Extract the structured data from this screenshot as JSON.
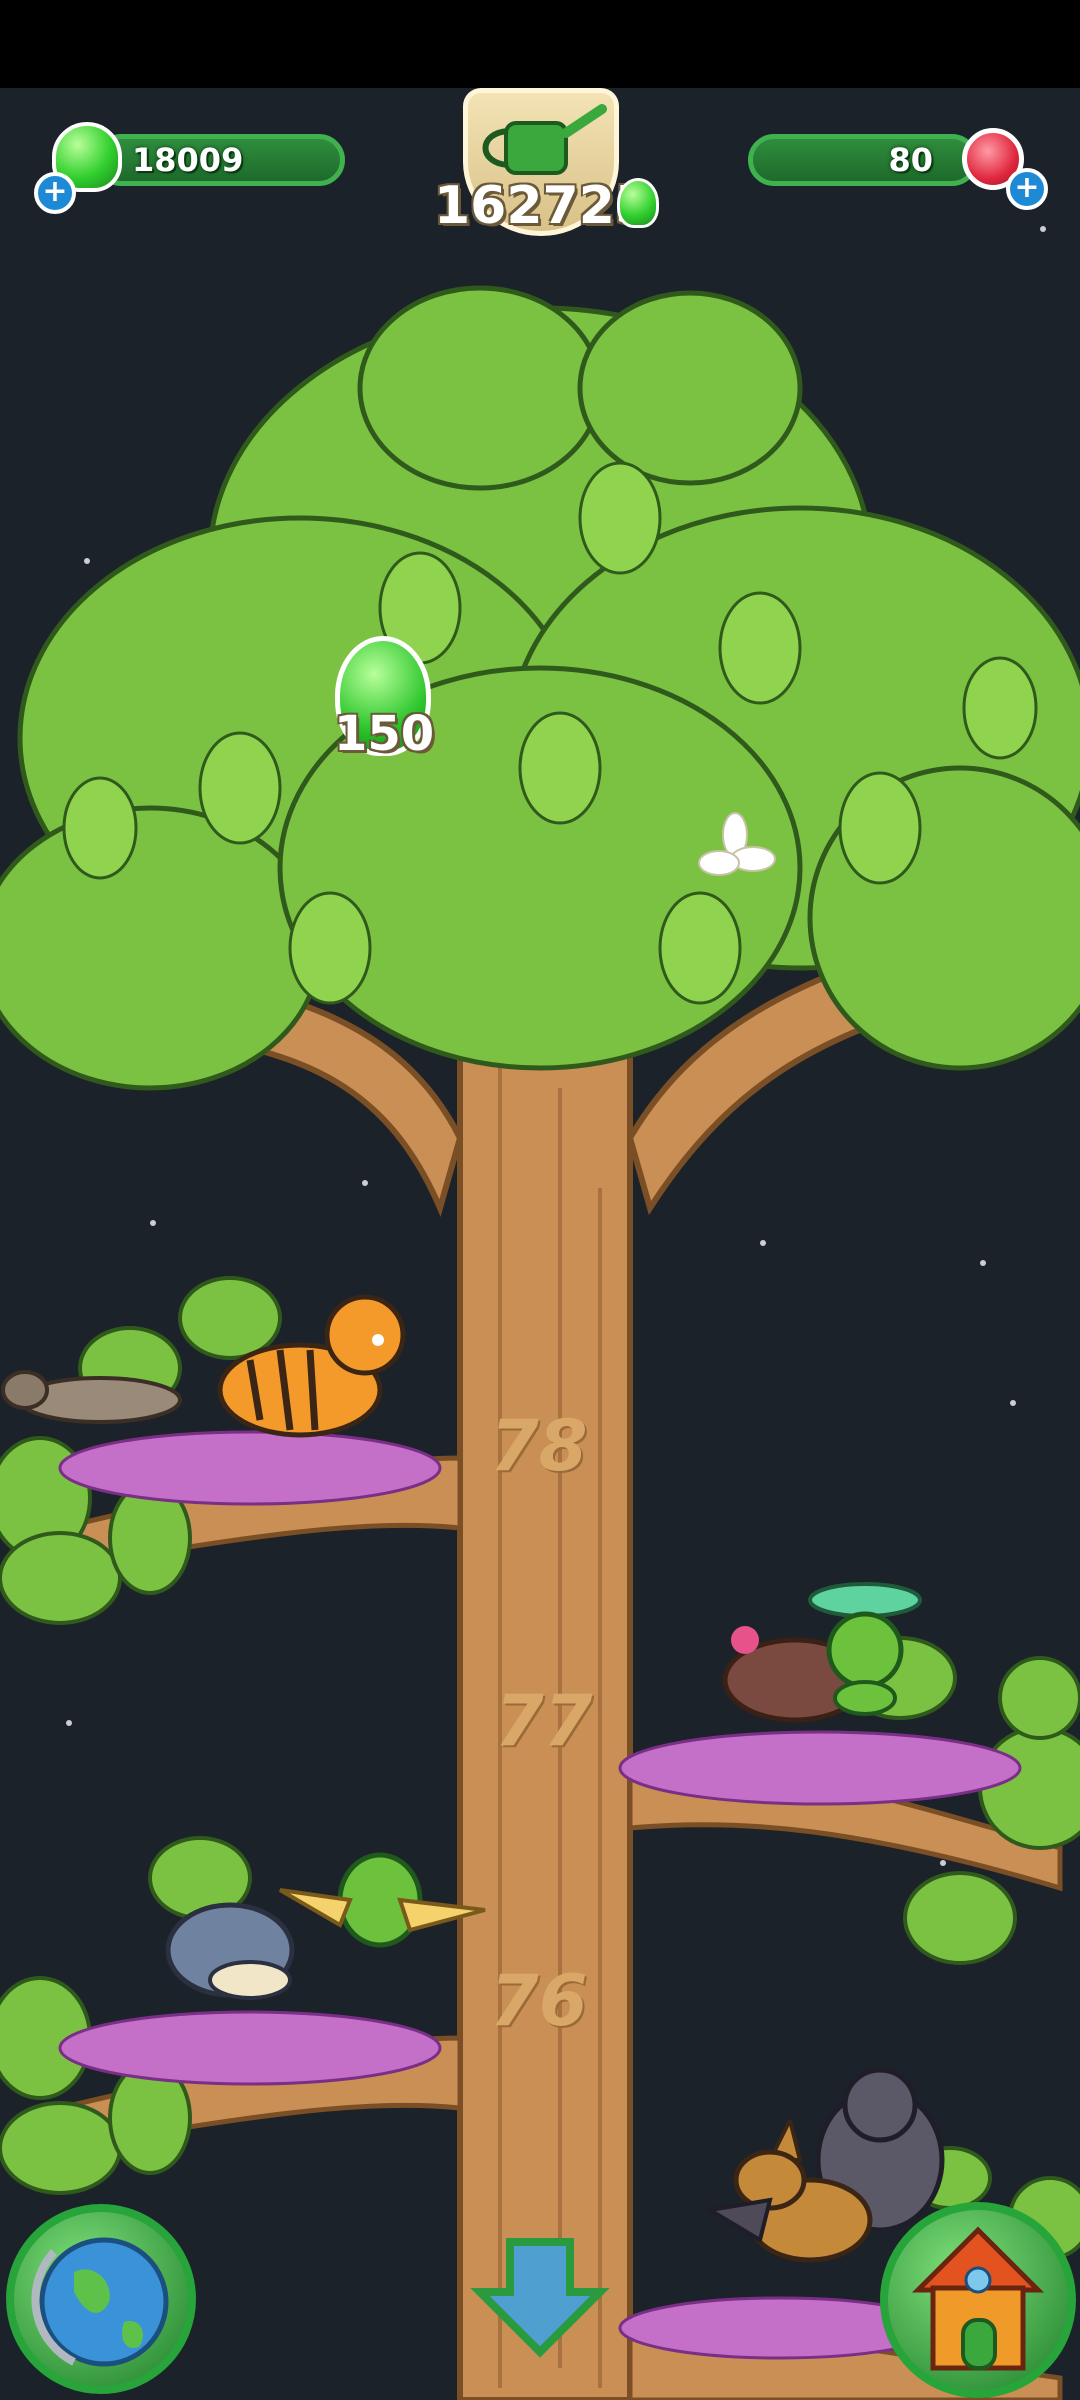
{
  "hud": {
    "drops_count": "18009",
    "gems_count": "80",
    "water_total": "162725",
    "floating_drop_reward": "150"
  },
  "tree": {
    "branch_levels": [
      "78",
      "77",
      "76"
    ]
  },
  "icons": {
    "drops": "green-drop-icon",
    "gems": "red-gem-icon",
    "add": "plus-icon",
    "watering_can": "watering-can-icon",
    "world": "globe-icon",
    "home": "house-icon",
    "scroll_down": "down-arrow-icon"
  },
  "colors": {
    "sky": "#1b2229",
    "leaf": "#7cc242",
    "trunk": "#c98f55",
    "hud_green": "#2f8d3d"
  }
}
